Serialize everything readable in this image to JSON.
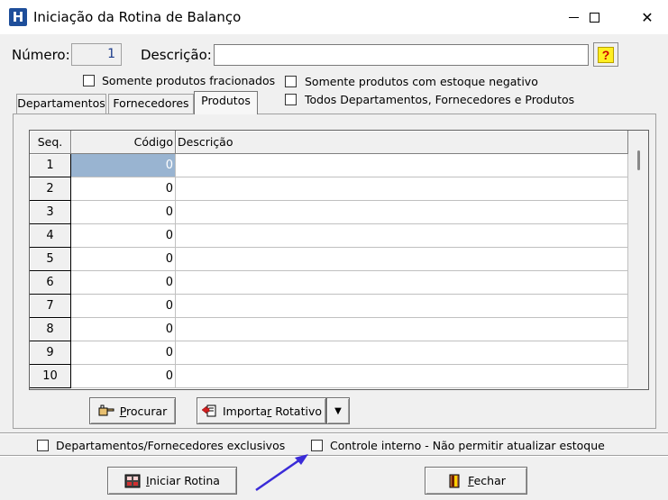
{
  "window": {
    "app_icon_letter": "H",
    "title": "Iniciação da Rotina de Balanço",
    "minimize_icon": "minimize-icon",
    "maximize_icon": "maximize-icon",
    "close_glyph": "✕"
  },
  "form": {
    "numero_label": "Número:",
    "numero_value": "1",
    "descricao_label": "Descrição:",
    "descricao_value": "",
    "help_glyph": "?"
  },
  "filters": {
    "fracionados": "Somente produtos fracionados",
    "estoque_negativo": "Somente produtos com estoque negativo",
    "todos": "Todos Departamentos, Fornecedores e Produtos"
  },
  "tabs": [
    {
      "label": "Departamentos",
      "active": false
    },
    {
      "label": "Fornecedores",
      "active": false
    },
    {
      "label": "Produtos",
      "active": true
    }
  ],
  "grid": {
    "headers": {
      "seq": "Seq.",
      "codigo": "Código",
      "descricao": "Descrição"
    },
    "rows": [
      {
        "seq": "1",
        "codigo": "0",
        "descricao": "",
        "selected": true
      },
      {
        "seq": "2",
        "codigo": "0",
        "descricao": ""
      },
      {
        "seq": "3",
        "codigo": "0",
        "descricao": ""
      },
      {
        "seq": "4",
        "codigo": "0",
        "descricao": ""
      },
      {
        "seq": "5",
        "codigo": "0",
        "descricao": ""
      },
      {
        "seq": "6",
        "codigo": "0",
        "descricao": ""
      },
      {
        "seq": "7",
        "codigo": "0",
        "descricao": ""
      },
      {
        "seq": "8",
        "codigo": "0",
        "descricao": ""
      },
      {
        "seq": "9",
        "codigo": "0",
        "descricao": ""
      },
      {
        "seq": "10",
        "codigo": "0",
        "descricao": ""
      }
    ]
  },
  "buttons": {
    "procurar_first": "P",
    "procurar_rest": "rocurar",
    "importar_pre": "Importa",
    "importar_ul": "r",
    "importar_post": " Rotativo",
    "dropdown_glyph": "▼",
    "iniciar_first": "I",
    "iniciar_rest": "niciar Rotina",
    "fechar_first": "F",
    "fechar_rest": "echar"
  },
  "bottom_options": {
    "exclusivos": "Departamentos/Fornecedores exclusivos",
    "controle": "Controle interno - Não permitir atualizar estoque"
  },
  "colors": {
    "selection": "#99b4d1",
    "annotation_arrow": "#3a2bd8"
  }
}
